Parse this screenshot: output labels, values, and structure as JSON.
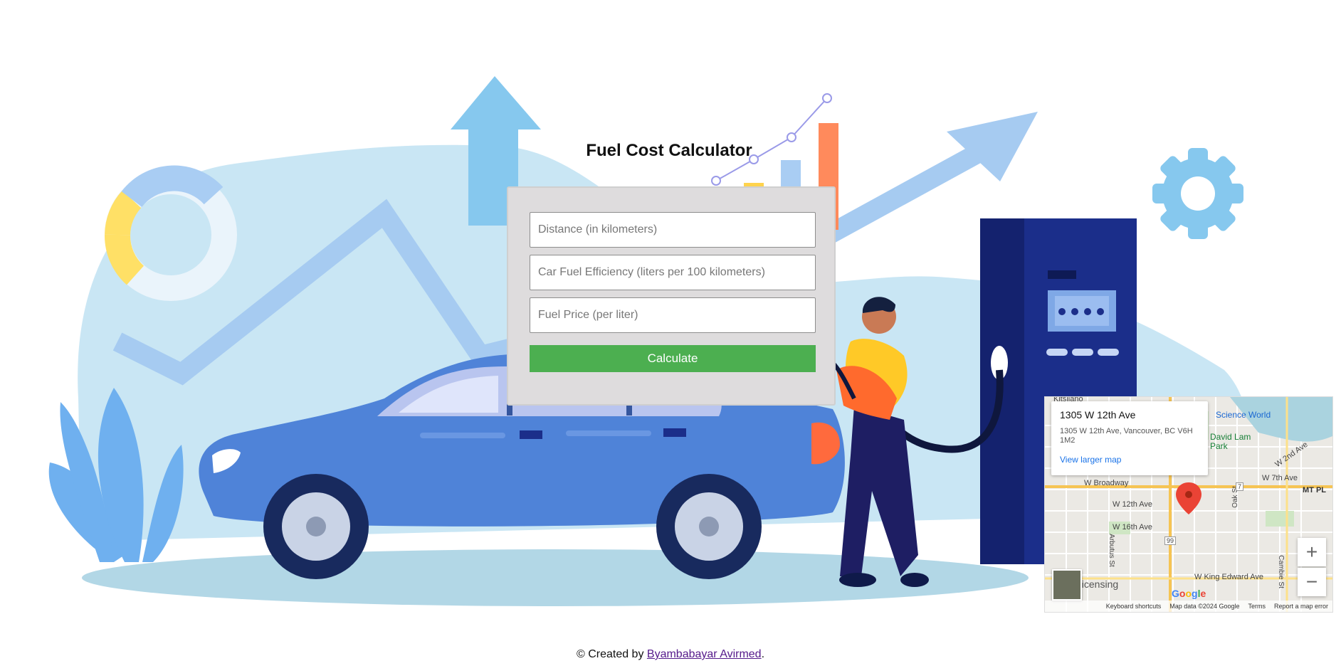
{
  "app": {
    "title": "Fuel Cost Calculator"
  },
  "form": {
    "distance_placeholder": "Distance (in kilometers)",
    "efficiency_placeholder": "Car Fuel Efficiency (liters per 100 kilometers)",
    "price_placeholder": "Fuel Price (per liter)",
    "distance_value": "",
    "efficiency_value": "",
    "price_value": "",
    "calculate_label": "Calculate"
  },
  "map": {
    "place_title": "1305 W 12th Ave",
    "place_address": "1305 W 12th Ave, Vancouver, BC V6H 1M2",
    "view_larger": "View larger map",
    "zoom_in": "+",
    "zoom_out": "−",
    "google_logo": "Google",
    "footer": {
      "keyboard": "Keyboard shortcuts",
      "data": "Map data ©2024 Google",
      "terms": "Terms",
      "report": "Report a map error"
    },
    "labels": {
      "science_world": "Science World",
      "david_lam": "David Lam Park",
      "w_broadway": "W Broadway",
      "w_12th": "W 12th Ave",
      "w_16th": "W 16th Ave",
      "w_7th": "W 7th Ave",
      "w_2nd": "W 2nd Ave",
      "mt_pl": "MT PL",
      "king_edward": "W King Edward Ave",
      "licensing": "Licensing",
      "kitsilano": "Kitsilano",
      "oak_st": "Oak St",
      "arbutus": "Arbutus St",
      "cambie": "Cambie St",
      "route_99": "99",
      "route_7": "7"
    }
  },
  "footer": {
    "prefix": "© Created by",
    "author": "Byambabayar Avirmed",
    "suffix": "."
  },
  "colors": {
    "button": "#4caf50",
    "card": "#dedcdd",
    "car": "#4f83d8",
    "pump": "#1b2e8a",
    "sky_blob": "#c9e6f4",
    "link": "#551a8b"
  }
}
